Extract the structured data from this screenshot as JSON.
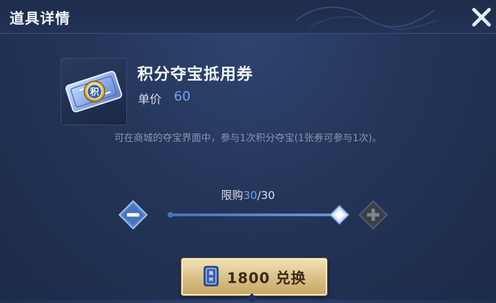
{
  "dialog": {
    "title": "道具详情",
    "close_icon": "close-icon"
  },
  "item": {
    "name": "积分夺宝抵用券",
    "price_label": "单价",
    "price_value": "60",
    "icon": "voucher-ticket-icon",
    "icon_badge_text": "积",
    "description": "可在商城的夺宝界面中，参与1次积分夺宝(1张券可参与1次)。"
  },
  "purchase": {
    "limit_label": "限购",
    "limit_current": "30",
    "limit_separator": "/",
    "limit_max": "30",
    "quantity_fraction": 1.0,
    "minus_icon": "minus-icon",
    "plus_icon": "plus-icon"
  },
  "exchange_button": {
    "icon": "limited-time-coupon-icon",
    "icon_text": "限时",
    "label": "1800 兑换"
  },
  "colors": {
    "accent_blue": "#6ea0f0",
    "gold_button": "#d9bf86",
    "background": "#243559"
  }
}
